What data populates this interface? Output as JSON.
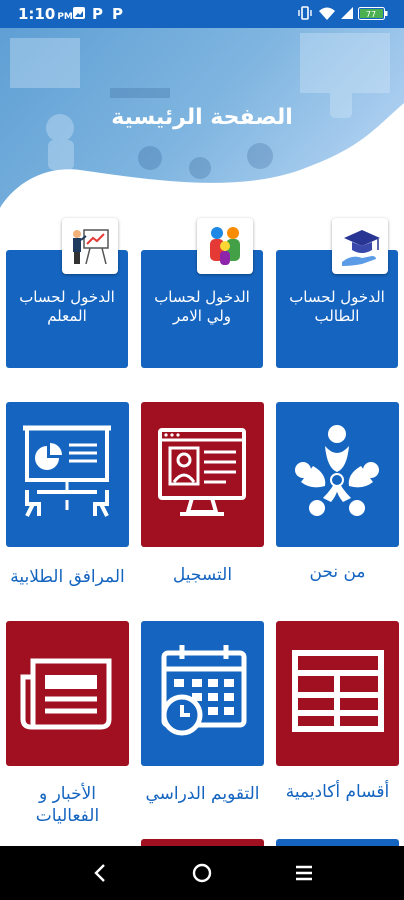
{
  "status_bar": {
    "time": "1:10",
    "ampm": "PM",
    "battery": "77"
  },
  "header": {
    "title": "الصفحة الرئيسية"
  },
  "login_tiles": [
    {
      "id": "teacher",
      "label": "الدخول لحساب المعلم",
      "icon": "teacher-presentation-icon"
    },
    {
      "id": "parent",
      "label": "الدخول لحساب ولي الامر",
      "icon": "family-icon"
    },
    {
      "id": "student",
      "label": "الدخول لحساب الطالب",
      "icon": "graduation-cap-hand-icon"
    }
  ],
  "menu_row1": [
    {
      "id": "facilities",
      "label": "المرافق الطلابية",
      "icon": "classroom-board-icon",
      "color": "#1565c0"
    },
    {
      "id": "registration",
      "label": "التسجيل",
      "icon": "online-form-icon",
      "color": "#a01020"
    },
    {
      "id": "about",
      "label": "من نحن",
      "icon": "people-circle-icon",
      "color": "#1565c0"
    }
  ],
  "menu_row2": [
    {
      "id": "news",
      "label": "الأخبار و الفعاليات",
      "icon": "newspaper-icon",
      "color": "#a01020"
    },
    {
      "id": "calendar",
      "label": "التقويم الدراسي",
      "icon": "calendar-clock-icon",
      "color": "#1565c0"
    },
    {
      "id": "departments",
      "label": "أقسام أكاديمية",
      "icon": "table-grid-icon",
      "color": "#a01020"
    }
  ],
  "colors": {
    "primary": "#1565c0",
    "accent": "#a01020"
  }
}
